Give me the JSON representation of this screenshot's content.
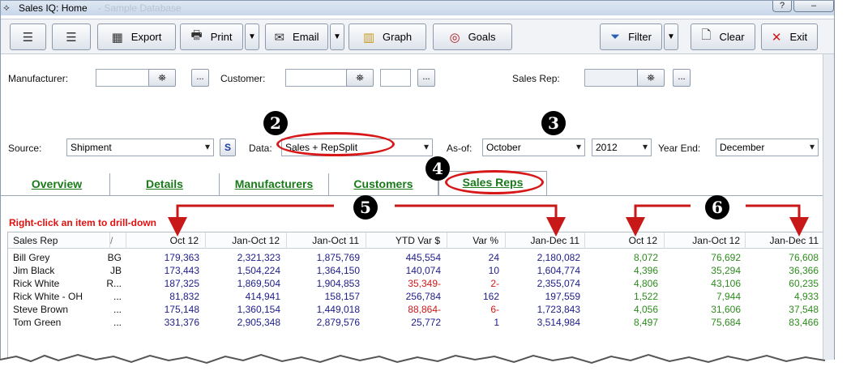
{
  "window": {
    "title": "Sales IQ: Home",
    "faint_title": "- Sample Database",
    "controls": [
      "?",
      "–"
    ]
  },
  "toolbar": {
    "export": "Export",
    "print": "Print",
    "email": "Email",
    "graph": "Graph",
    "goals": "Goals",
    "filter": "Filter",
    "clear": "Clear",
    "exit": "Exit"
  },
  "filters": {
    "manufacturer_label": "Manufacturer:",
    "customer_label": "Customer:",
    "sales_rep_label": "Sales Rep:",
    "source_label": "Source:",
    "source_value": "Shipment",
    "s_button": "S",
    "data_label": "Data:",
    "data_value": "Sales + RepSplit",
    "asof_label": "As-of:",
    "asof_month": "October",
    "asof_year": "2012",
    "year_end_label": "Year End:",
    "year_end_value": "December",
    "dots": "..."
  },
  "tabs": [
    {
      "label": "Overview"
    },
    {
      "label": "Details"
    },
    {
      "label": "Manufacturers"
    },
    {
      "label": "Customers"
    },
    {
      "label": "Sales Reps"
    }
  ],
  "drill_hint": "Right-click an item to drill-down",
  "callouts": [
    "2",
    "3",
    "4",
    "5",
    "6"
  ],
  "grid": {
    "columns": [
      "Sales Rep",
      "/",
      "Oct 12",
      "Jan-Oct 12",
      "Jan-Oct 11",
      "YTD Var $",
      "Var %",
      "Jan-Dec 11",
      "Oct 12",
      "Jan-Oct 12",
      "Jan-Dec 11"
    ],
    "rows": [
      {
        "name": "Bill Grey",
        "code": "BG",
        "c1": "179,363",
        "c2": "2,321,323",
        "c3": "1,875,769",
        "c4": "445,554",
        "c5": "24",
        "c6": "2,180,082",
        "c7": "8,072",
        "c8": "76,692",
        "c9": "76,608",
        "neg": false
      },
      {
        "name": "Jim Black",
        "code": "JB",
        "c1": "173,443",
        "c2": "1,504,224",
        "c3": "1,364,150",
        "c4": "140,074",
        "c5": "10",
        "c6": "1,604,774",
        "c7": "4,396",
        "c8": "35,294",
        "c9": "36,366",
        "neg": false
      },
      {
        "name": "Rick White",
        "code": "R...",
        "c1": "187,325",
        "c2": "1,869,504",
        "c3": "1,904,853",
        "c4": "35,349-",
        "c5": "2-",
        "c6": "2,355,074",
        "c7": "4,806",
        "c8": "43,106",
        "c9": "60,235",
        "neg": true
      },
      {
        "name": "Rick White - OH",
        "code": "...",
        "c1": "81,832",
        "c2": "414,941",
        "c3": "158,157",
        "c4": "256,784",
        "c5": "162",
        "c6": "197,559",
        "c7": "1,522",
        "c8": "7,944",
        "c9": "4,933",
        "neg": false
      },
      {
        "name": "Steve Brown",
        "code": "...",
        "c1": "175,148",
        "c2": "1,360,154",
        "c3": "1,449,018",
        "c4": "88,864-",
        "c5": "6-",
        "c6": "1,723,843",
        "c7": "4,056",
        "c8": "31,606",
        "c9": "37,548",
        "neg": true
      },
      {
        "name": "Tom Green",
        "code": "...",
        "c1": "331,376",
        "c2": "2,905,348",
        "c3": "2,879,576",
        "c4": "25,772",
        "c5": "1",
        "c6": "3,514,984",
        "c7": "8,497",
        "c8": "75,684",
        "c9": "83,466",
        "neg": false
      }
    ]
  }
}
